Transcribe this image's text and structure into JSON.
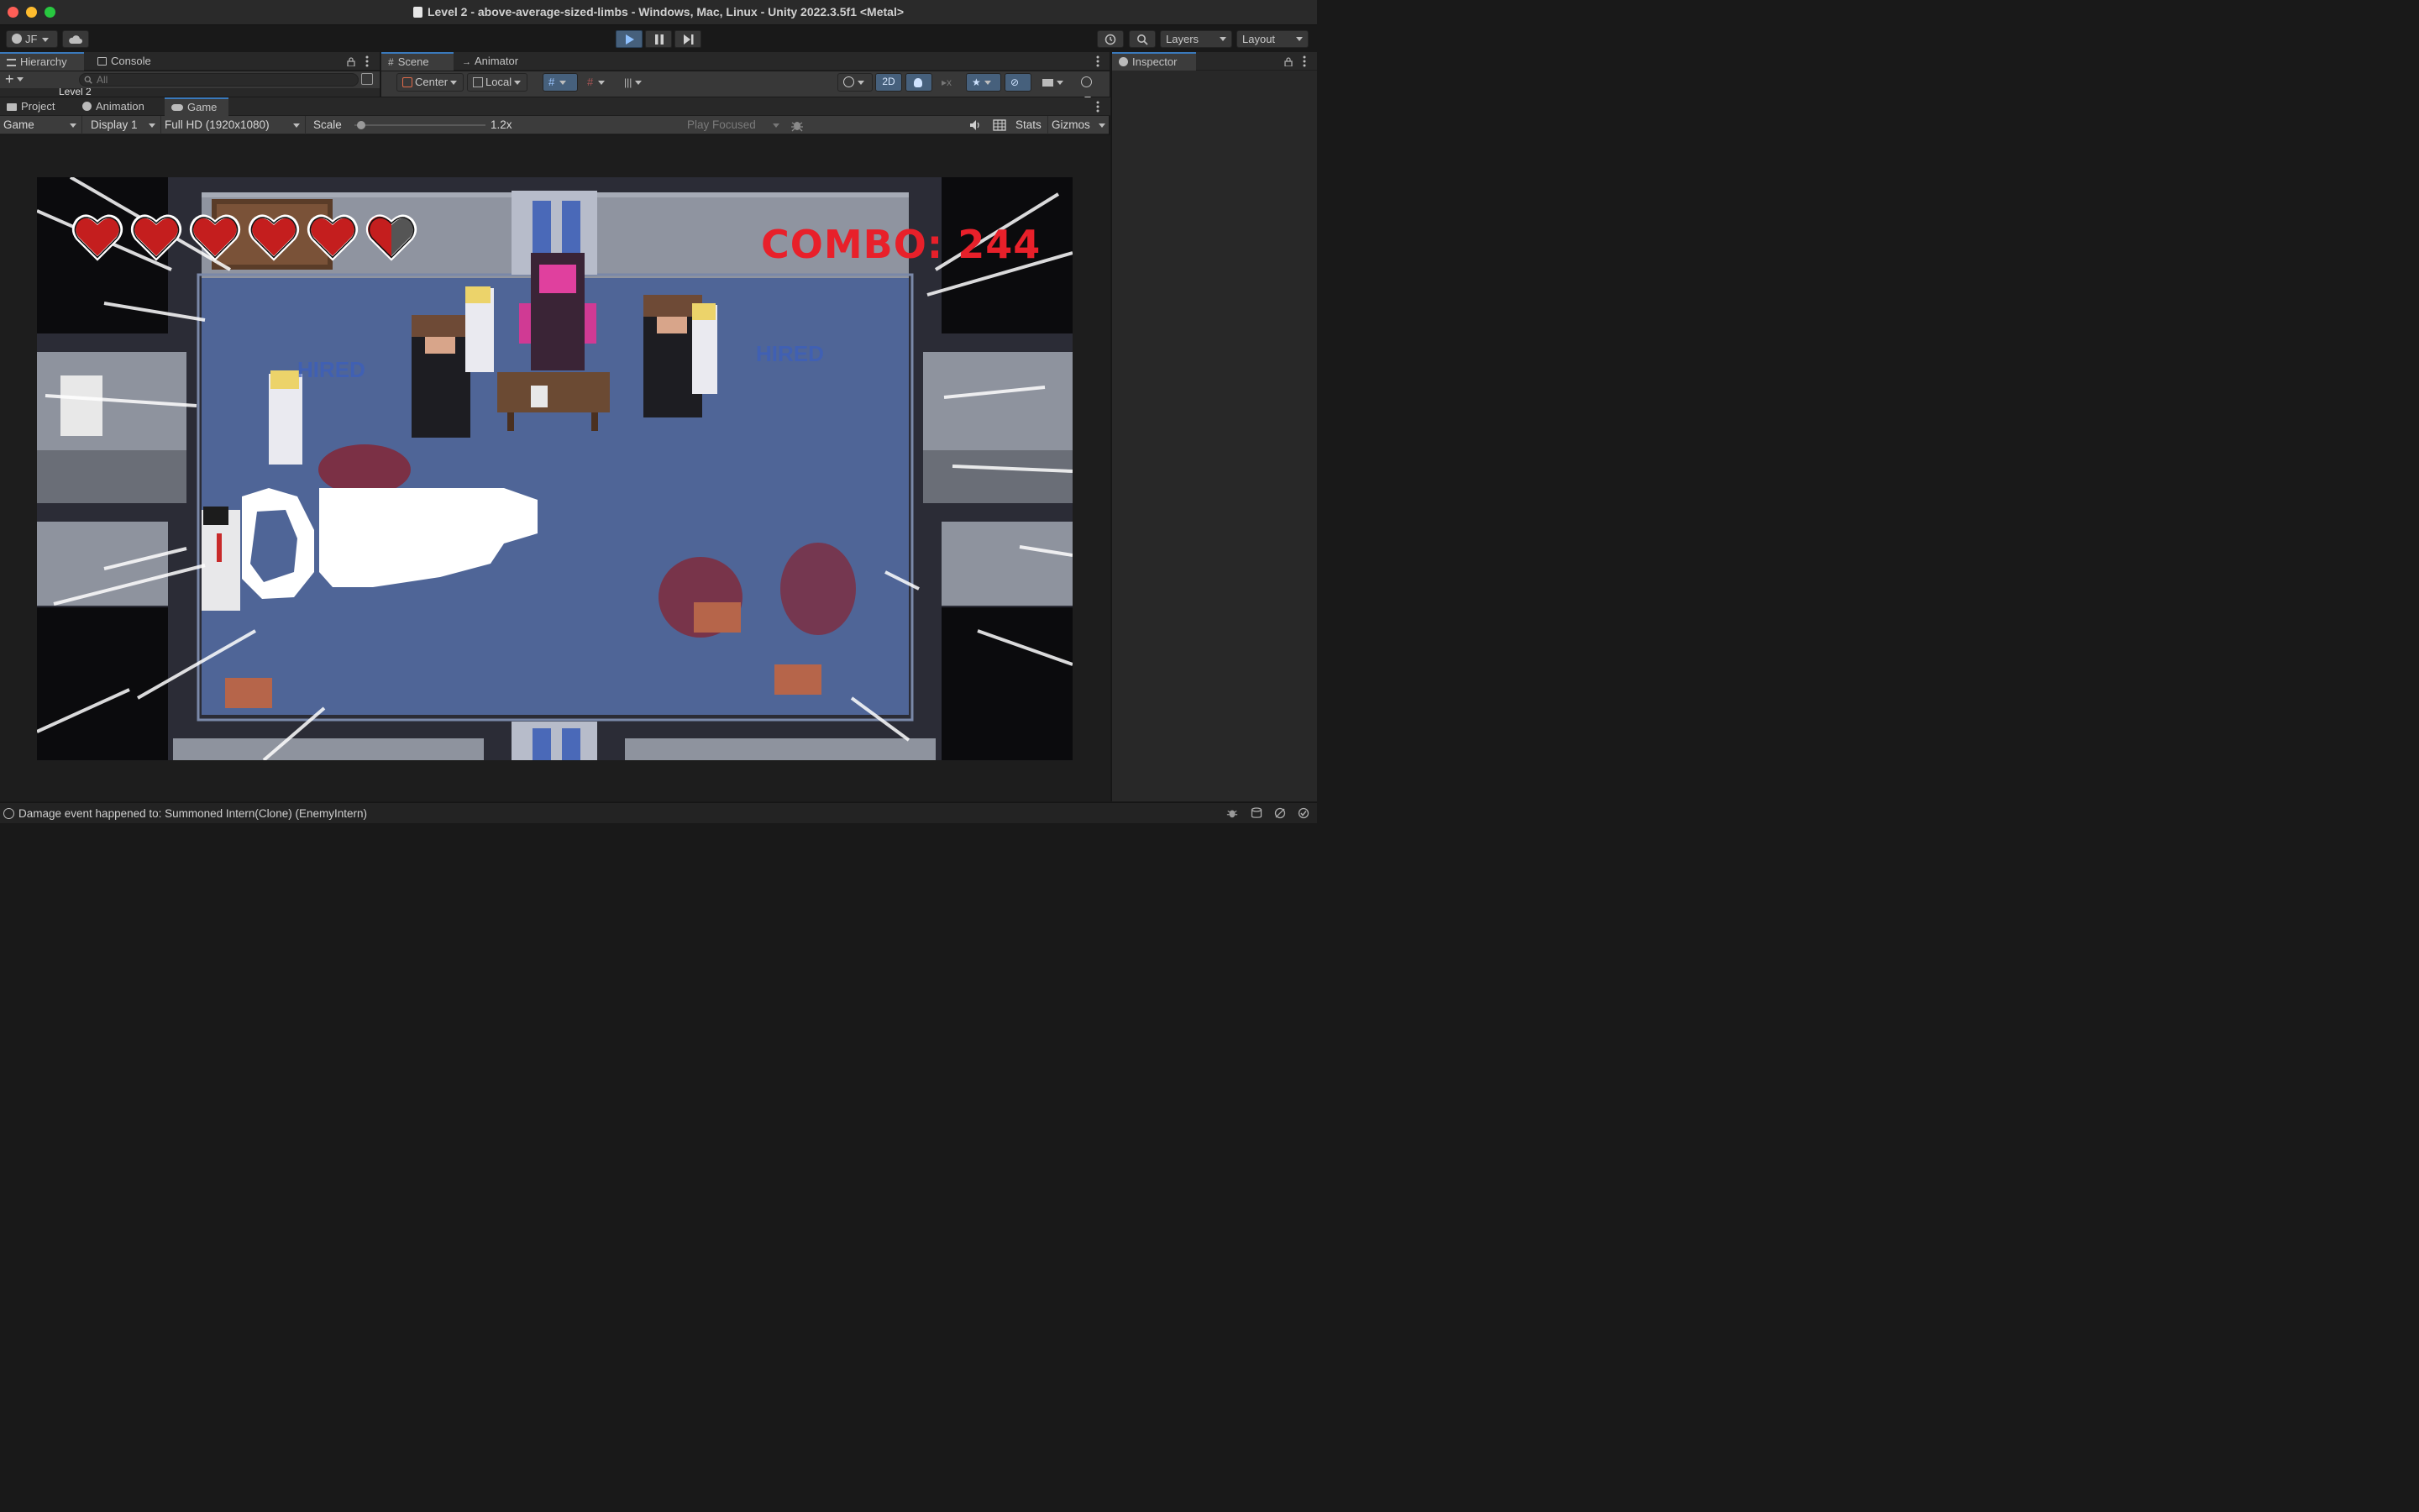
{
  "window": {
    "title": "Level 2 - above-average-sized-limbs - Windows, Mac, Linux - Unity 2022.3.5f1 <Metal>"
  },
  "toolbar": {
    "account_label": "JF",
    "layers_label": "Layers",
    "layout_label": "Layout"
  },
  "hierarchy": {
    "tab_hierarchy": "Hierarchy",
    "tab_console": "Console",
    "search_placeholder": "All",
    "root_item": "Level 2"
  },
  "scene": {
    "tab_scene": "Scene",
    "tab_animator": "Animator",
    "pivot_label": "Center",
    "space_label": "Local",
    "mode_2d_label": "2D"
  },
  "bottom_tabs": {
    "project": "Project",
    "animation": "Animation",
    "game": "Game"
  },
  "game_toolbar": {
    "view_mode": "Game",
    "display": "Display 1",
    "resolution": "Full HD (1920x1080)",
    "scale_label": "Scale",
    "scale_value": "1.2x",
    "scale_fraction": 0.0,
    "play_mode": "Play Focused",
    "stats_label": "Stats",
    "gizmos_label": "Gizmos"
  },
  "inspector": {
    "tab_label": "Inspector"
  },
  "game_hud": {
    "combo_text": "COMBO: 244",
    "hearts_full": 5,
    "hearts_total": 6,
    "hired_text": "HIRED"
  },
  "status_bar": {
    "message": "Damage event happened to: Summoned Intern(Clone) (EnemyIntern)"
  },
  "colors": {
    "accent_blue": "#3a79bb",
    "combo_red": "#e8202a",
    "floor_blue": "#4f6597",
    "heart_red": "#c41e1e"
  }
}
